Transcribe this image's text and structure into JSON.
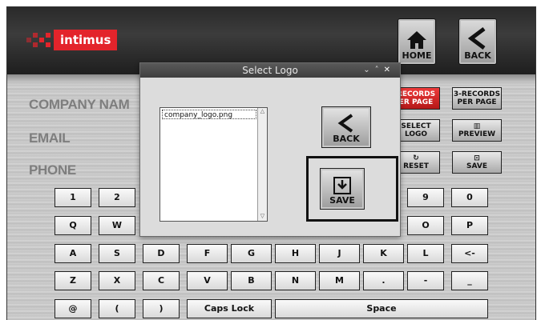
{
  "brand": {
    "logo_text": "intimus",
    "logo_color": "#e3242b"
  },
  "nav": {
    "home_label": "HOME",
    "back_label": "BACK"
  },
  "fields": {
    "company_label": "COMPANY NAM",
    "email_label": "EMAIL",
    "phone_label": "PHONE"
  },
  "side_buttons": {
    "records_red_line1": "RECORDS",
    "records_red_line2": "ER PAGE",
    "records3_line1": "3-RECORDS",
    "records3_line2": "PER PAGE",
    "select_logo_line1": "SELECT",
    "select_logo_line2": "LOGO",
    "preview": "PREVIEW",
    "reset": "RESET",
    "save": "SAVE"
  },
  "keyboard": {
    "row1": [
      "1",
      "2",
      "9",
      "0"
    ],
    "row2": [
      "Q",
      "W",
      "O",
      "P"
    ],
    "row3": [
      "A",
      "S",
      "D",
      "F",
      "G",
      "H",
      "J",
      "K",
      "L",
      "<-"
    ],
    "row4": [
      "Z",
      "X",
      "C",
      "V",
      "B",
      "N",
      "M",
      ".",
      "-",
      "_"
    ],
    "row5": [
      "@",
      "(",
      ")",
      "Caps Lock",
      "Space"
    ]
  },
  "dialog": {
    "title": "Select Logo",
    "files": [
      "company_logo.png"
    ],
    "back_label": "BACK",
    "save_label": "SAVE"
  }
}
